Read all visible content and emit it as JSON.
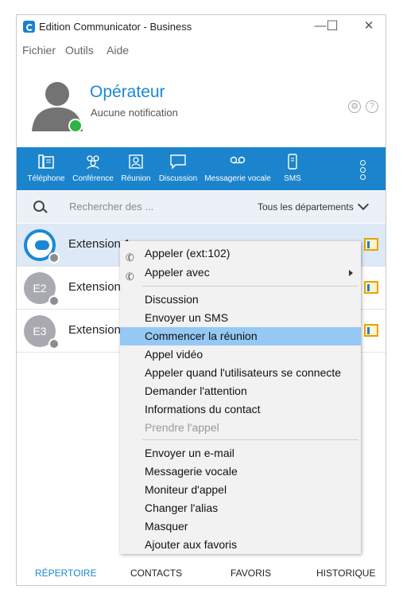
{
  "window": {
    "title": "Edition Communicator - Business",
    "minimize": "—",
    "maximize": "☐",
    "close": "✕"
  },
  "menubar": [
    "Fichier",
    "Outils",
    "Aide"
  ],
  "profile": {
    "name": "Opérateur",
    "status": "Aucune notification",
    "presence_color": "#2fb344"
  },
  "toolbar": {
    "items": [
      "Téléphone",
      "Conférence",
      "Réunion",
      "Discussion",
      "Messagerie vocale",
      "SMS"
    ],
    "background": "#1b84cc"
  },
  "search": {
    "placeholder": "Rechercher des ...",
    "department": "Tous les départements"
  },
  "contacts": [
    {
      "initials": "",
      "name": "Extension 1"
    },
    {
      "initials": "E2",
      "name": "Extension"
    },
    {
      "initials": "E3",
      "name": "Extension"
    }
  ],
  "context_menu": {
    "items": [
      "Appeler (ext:102)",
      "Appeler avec",
      "Discussion",
      "Envoyer un SMS",
      "Commencer la réunion",
      "Appel vidéo",
      "Appeler quand l'utilisateurs se connecte",
      "Demander l'attention",
      "Informations du contact",
      "Prendre l'appel",
      "Envoyer un e-mail",
      "Messagerie vocale",
      "Moniteur d'appel",
      "Changer l'alias",
      "Masquer",
      "Ajouter aux favoris"
    ],
    "highlight_color": "#96c8f5"
  },
  "bottom_tabs": [
    "RÉPERTOIRE",
    "CONTACTS",
    "FAVORIS",
    "HISTORIQUE"
  ],
  "accent_color": "#1b88d4"
}
